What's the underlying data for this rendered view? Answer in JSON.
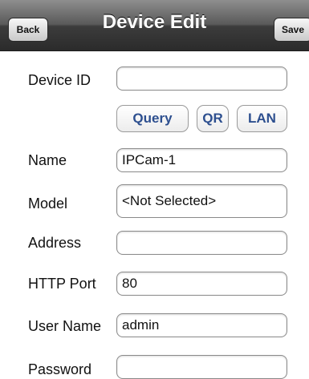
{
  "navbar": {
    "title": "Device Edit",
    "back_label": "Back",
    "save_label": "Save"
  },
  "form": {
    "device_id": {
      "label": "Device ID",
      "value": ""
    },
    "query_buttons": {
      "query": "Query",
      "qr": "QR",
      "lan": "LAN"
    },
    "name": {
      "label": "Name",
      "value": "IPCam-1"
    },
    "model": {
      "label": "Model",
      "value": "<Not Selected>"
    },
    "address": {
      "label": "Address",
      "value": ""
    },
    "http_port": {
      "label": "HTTP Port",
      "value": "80"
    },
    "user_name": {
      "label": "User Name",
      "value": "admin"
    },
    "password": {
      "label": "Password",
      "value": ""
    }
  }
}
